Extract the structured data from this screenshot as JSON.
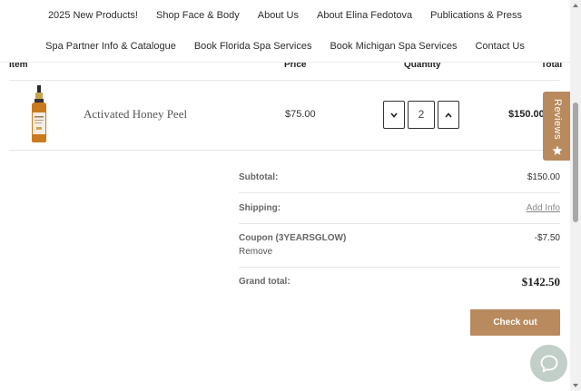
{
  "nav": {
    "row1": [
      "2025 New Products!",
      "Shop Face & Body",
      "About Us",
      "About Elina Fedotova",
      "Publications & Press"
    ],
    "row2": [
      "Spa Partner Info & Catalogue",
      "Book Florida Spa Services",
      "Book Michigan Spa Services",
      "Contact Us"
    ]
  },
  "table": {
    "headers": {
      "item": "Item",
      "price": "Price",
      "quantity": "Quantity",
      "total": "Total"
    }
  },
  "cart": {
    "product": {
      "name": "Activated Honey Peel",
      "price": "$75.00",
      "quantity": "2",
      "total": "$150.00"
    }
  },
  "summary": {
    "subtotal_label": "Subtotal:",
    "subtotal_value": "$150.00",
    "shipping_label": "Shipping:",
    "shipping_value": "Add Info",
    "coupon_label": "Coupon (3YEARSGLOW)",
    "coupon_value": "-$7.50",
    "remove_label": "Remove",
    "grand_label": "Grand total:",
    "grand_value": "$142.50"
  },
  "checkout_label": "Check out",
  "reviews_label": "Reviews",
  "colors": {
    "accent": "#b88a5e",
    "chat": "#c2cfc9"
  },
  "icons": {
    "qty_down": "chevron-down-icon",
    "qty_up": "chevron-up-icon",
    "reviews": "star-icon",
    "chat": "chat-bubble-icon"
  }
}
